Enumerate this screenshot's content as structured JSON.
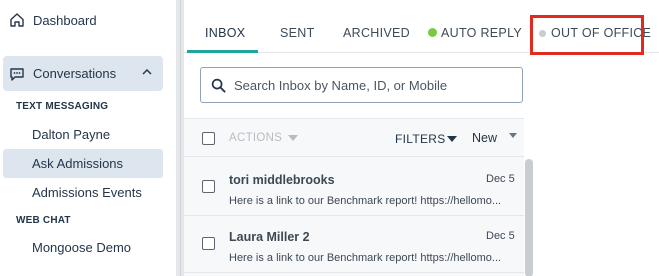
{
  "sidebar": {
    "dashboard_label": "Dashboard",
    "conversations_label": "Conversations",
    "sections": [
      {
        "heading": "TEXT MESSAGING",
        "items": [
          "Dalton Payne",
          "Ask Admissions",
          "Admissions Events"
        ]
      },
      {
        "heading": "WEB CHAT",
        "items": [
          "Mongoose Demo"
        ]
      }
    ],
    "active_item": "Ask Admissions"
  },
  "tabs": [
    {
      "label": "INBOX",
      "active": true
    },
    {
      "label": "SENT"
    },
    {
      "label": "ARCHIVED"
    },
    {
      "label": "AUTO REPLY",
      "dot_color": "#7ac943"
    },
    {
      "label": "OUT OF OFFICE",
      "dot_color": "#c8cdd2"
    }
  ],
  "search": {
    "placeholder": "Search Inbox by Name, ID, or Mobile"
  },
  "toolbar": {
    "actions_label": "ACTIONS",
    "filters_label": "FILTERS",
    "sort_value": "New"
  },
  "messages": [
    {
      "name": "tori middlebrooks",
      "date": "Dec 5",
      "preview": "Here is a link to our Benchmark report! https://hellomo..."
    },
    {
      "name": "Laura Miller 2",
      "date": "Dec 5",
      "preview": "Here is a link to our Benchmark report! https://hellomo..."
    }
  ],
  "colors": {
    "accent": "#1fa4a0",
    "highlight": "#e02b1e",
    "selected_bg": "#dde5ee"
  }
}
